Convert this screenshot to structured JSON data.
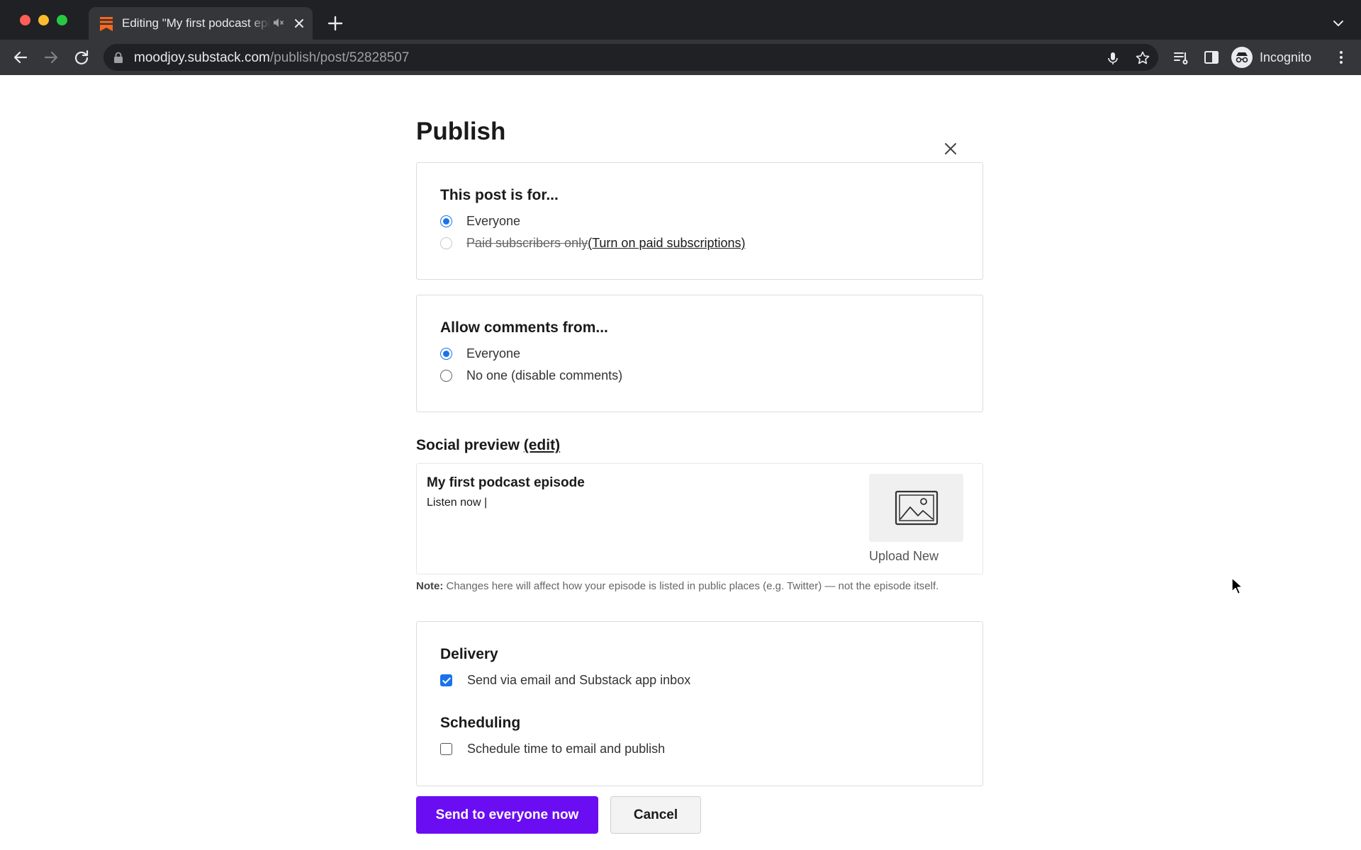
{
  "browser": {
    "tab_title": "Editing \"My first podcast episode\"",
    "url_host": "moodjoy.substack.com",
    "url_path": "/publish/post/52828507",
    "profile_label": "Incognito",
    "accent_color": "#ff6719"
  },
  "page": {
    "title": "Publish"
  },
  "audience": {
    "heading": "This post is for...",
    "option_everyone": "Everyone",
    "option_paid": "Paid subscribers only",
    "option_paid_link": "(Turn on paid subscriptions)",
    "selected": "Everyone"
  },
  "comments": {
    "heading": "Allow comments from...",
    "option_everyone": "Everyone",
    "option_none": "No one (disable comments)",
    "selected": "Everyone"
  },
  "social_preview": {
    "heading": "Social preview",
    "edit_link": "(edit)",
    "post_title": "My first podcast episode",
    "post_subtitle": "Listen now |",
    "upload_label": "Upload New"
  },
  "note": {
    "label": "Note:",
    "text": "Changes here will affect how your episode is listed in public places (e.g. Twitter) — not the episode itself."
  },
  "delivery": {
    "heading": "Delivery",
    "option_email": "Send via email and Substack app inbox",
    "email_checked": true
  },
  "scheduling": {
    "heading": "Scheduling",
    "option_schedule": "Schedule time to email and publish",
    "schedule_checked": false
  },
  "actions": {
    "primary_label": "Send to everyone now",
    "cancel_label": "Cancel",
    "primary_color": "#6a0df2"
  }
}
